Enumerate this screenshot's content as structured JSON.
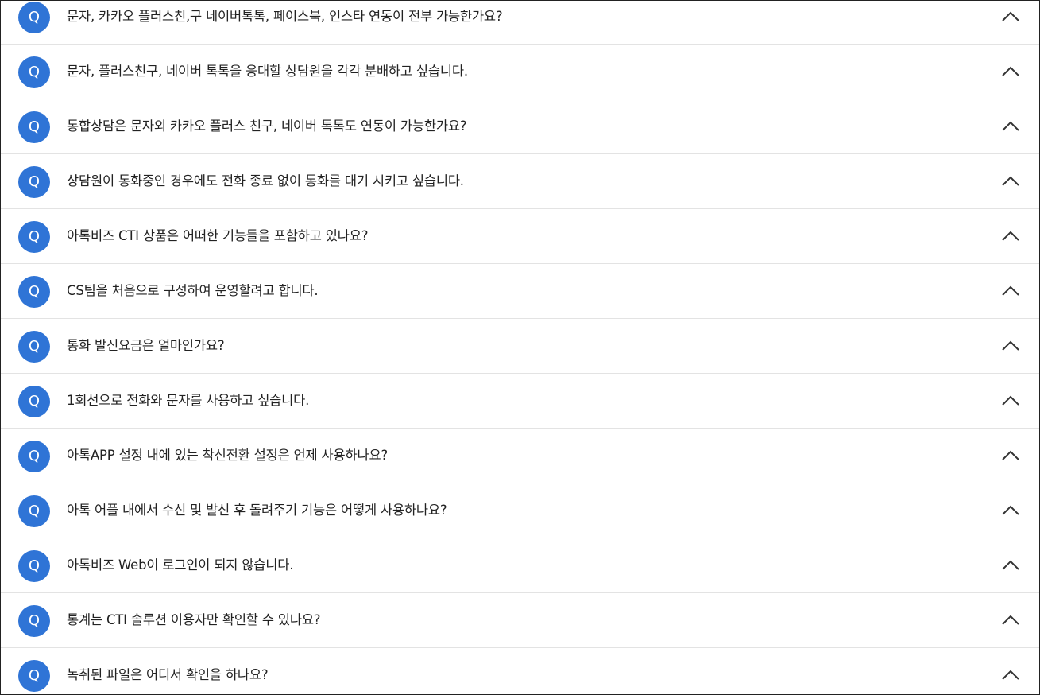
{
  "badge_label": "Q",
  "accent_color": "#2f74d6",
  "faq_items": [
    {
      "question": "문자, 카카오 플러스친,구 네이버톡톡, 페이스북, 인스타 연동이 전부 가능한가요?"
    },
    {
      "question": "문자, 플러스친구, 네이버 톡톡을 응대할 상담원을 각각 분배하고 싶습니다."
    },
    {
      "question": "통합상담은 문자외 카카오 플러스 친구, 네이버 톡톡도 연동이 가능한가요?"
    },
    {
      "question": "상담원이 통화중인 경우에도 전화 종료 없이 통화를 대기 시키고 싶습니다."
    },
    {
      "question": "아톡비즈 CTI 상품은 어떠한 기능들을 포함하고 있나요?"
    },
    {
      "question": "CS팀을 처음으로 구성하여 운영할려고 합니다."
    },
    {
      "question": "통화 발신요금은 얼마인가요?"
    },
    {
      "question": "1회선으로 전화와 문자를 사용하고 싶습니다."
    },
    {
      "question": "아톡APP 설정 내에 있는 착신전환 설정은 언제 사용하나요?"
    },
    {
      "question": "아톡 어플 내에서 수신 및 발신 후 돌려주기 기능은 어떻게 사용하나요?"
    },
    {
      "question": "아톡비즈 Web이 로그인이 되지 않습니다."
    },
    {
      "question": "통계는 CTI 솔루션 이용자만 확인할 수 있나요?"
    },
    {
      "question": "녹취된 파일은 어디서 확인을 하나요?"
    }
  ]
}
